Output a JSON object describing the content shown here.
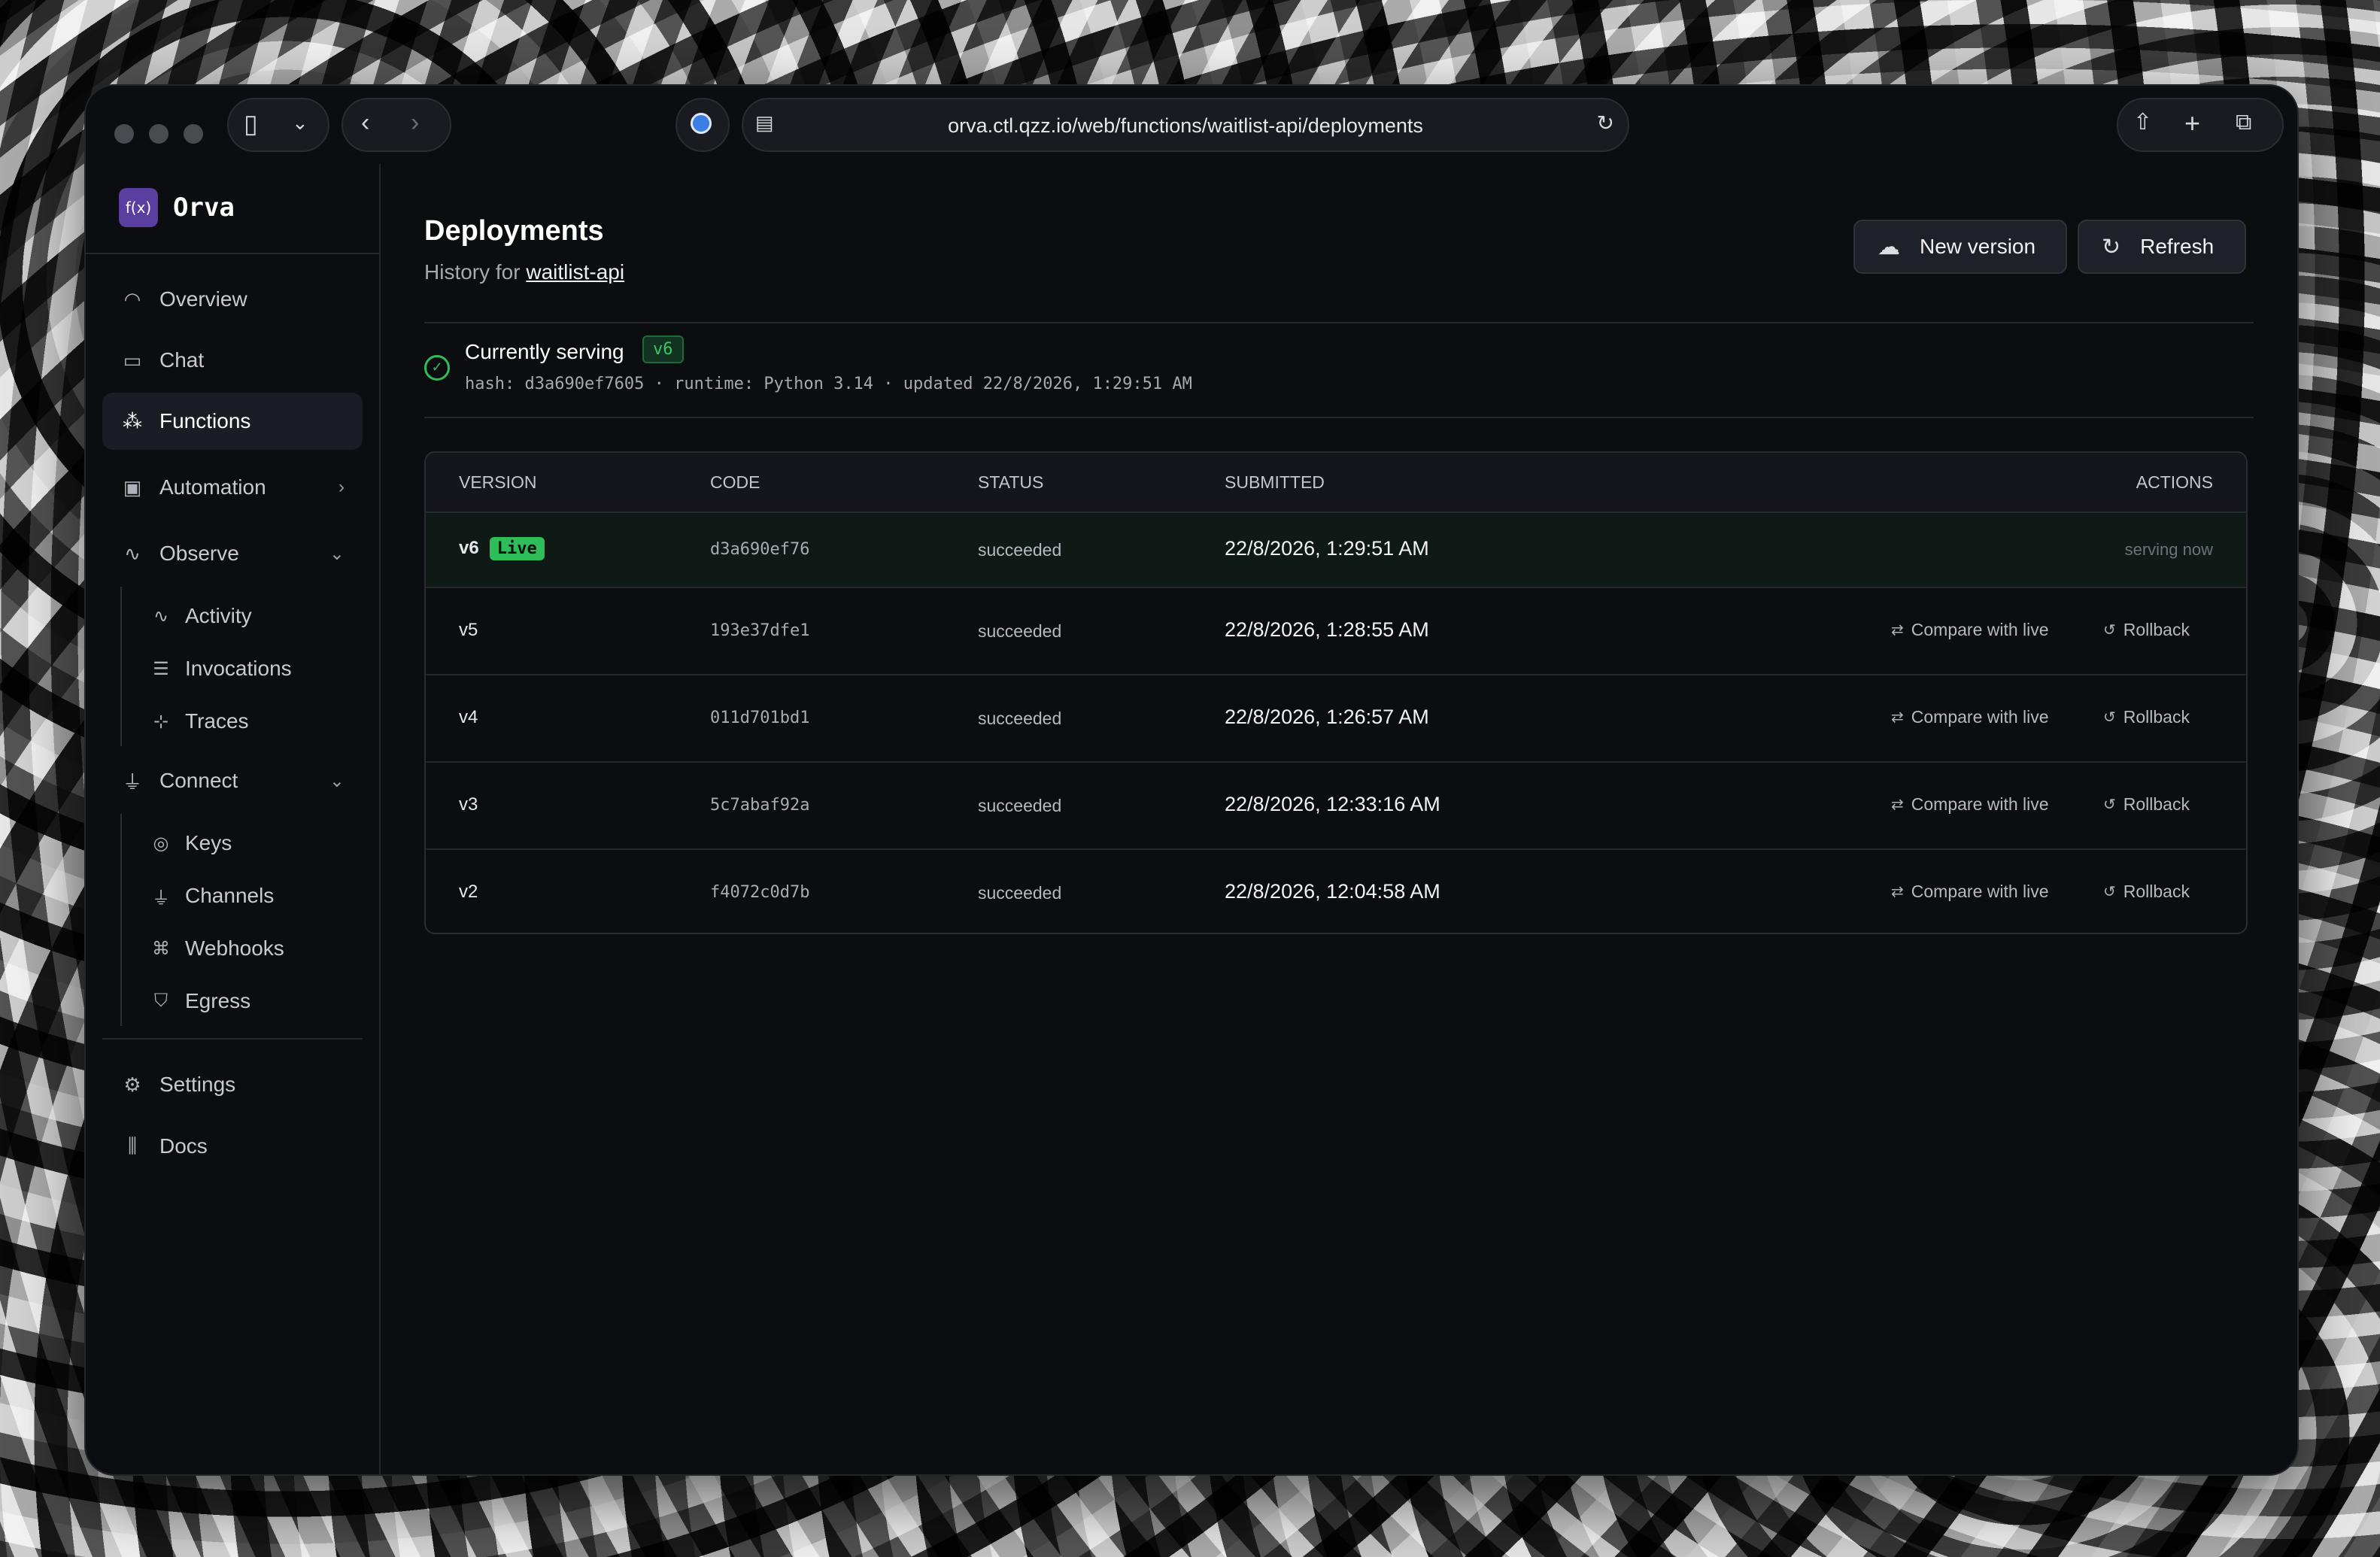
{
  "browser": {
    "url": "orva.ctl.qzz.io/web/functions/waitlist-api/deployments"
  },
  "brand": {
    "logo": "f(x)",
    "name": "Orva"
  },
  "sidebar": {
    "items": [
      {
        "label": "Overview",
        "icon": "gauge-icon"
      },
      {
        "label": "Chat",
        "icon": "chat-icon"
      },
      {
        "label": "Functions",
        "icon": "functions-icon",
        "active": true
      },
      {
        "label": "Automation",
        "icon": "calendar-icon"
      },
      {
        "label": "Observe",
        "icon": "pulse-icon"
      },
      {
        "label": "Connect",
        "icon": "plug-icon"
      },
      {
        "label": "Settings",
        "icon": "gear-icon"
      },
      {
        "label": "Docs",
        "icon": "library-icon"
      }
    ],
    "observe_children": [
      "Activity",
      "Invocations",
      "Traces"
    ],
    "connect_children": [
      "Keys",
      "Channels",
      "Webhooks",
      "Egress"
    ]
  },
  "page": {
    "title": "Deployments",
    "subtitle_prefix": "History for",
    "function_name": "waitlist-api",
    "new_version_label": "New version",
    "refresh_label": "Refresh"
  },
  "serving": {
    "title": "Currently serving",
    "version": "v6",
    "meta": "hash: d3a690ef7605 · runtime: Python 3.14 · updated 22/8/2026, 1:29:51 AM"
  },
  "table": {
    "headers": [
      "VERSION",
      "CODE",
      "STATUS",
      "SUBMITTED",
      "ACTIONS"
    ],
    "live_badge": "Live",
    "serving_now": "serving now",
    "compare_label": "Compare with live",
    "rollback_label": "Rollback",
    "rows": [
      {
        "version": "v6",
        "code": "d3a690ef76",
        "status": "succeeded",
        "submitted": "22/8/2026, 1:29:51 AM"
      },
      {
        "version": "v5",
        "code": "193e37dfe1",
        "status": "succeeded",
        "submitted": "22/8/2026, 1:28:55 AM"
      },
      {
        "version": "v4",
        "code": "011d701bd1",
        "status": "succeeded",
        "submitted": "22/8/2026, 1:26:57 AM"
      },
      {
        "version": "v3",
        "code": "5c7abaf92a",
        "status": "succeeded",
        "submitted": "22/8/2026, 12:33:16 AM"
      },
      {
        "version": "v2",
        "code": "f4072c0d7b",
        "status": "succeeded",
        "submitted": "22/8/2026, 12:04:58 AM"
      }
    ]
  },
  "colors": {
    "accent_green": "#2fbd5a",
    "brand_purple": "#5b3fa0",
    "background": "#0c0d11"
  }
}
